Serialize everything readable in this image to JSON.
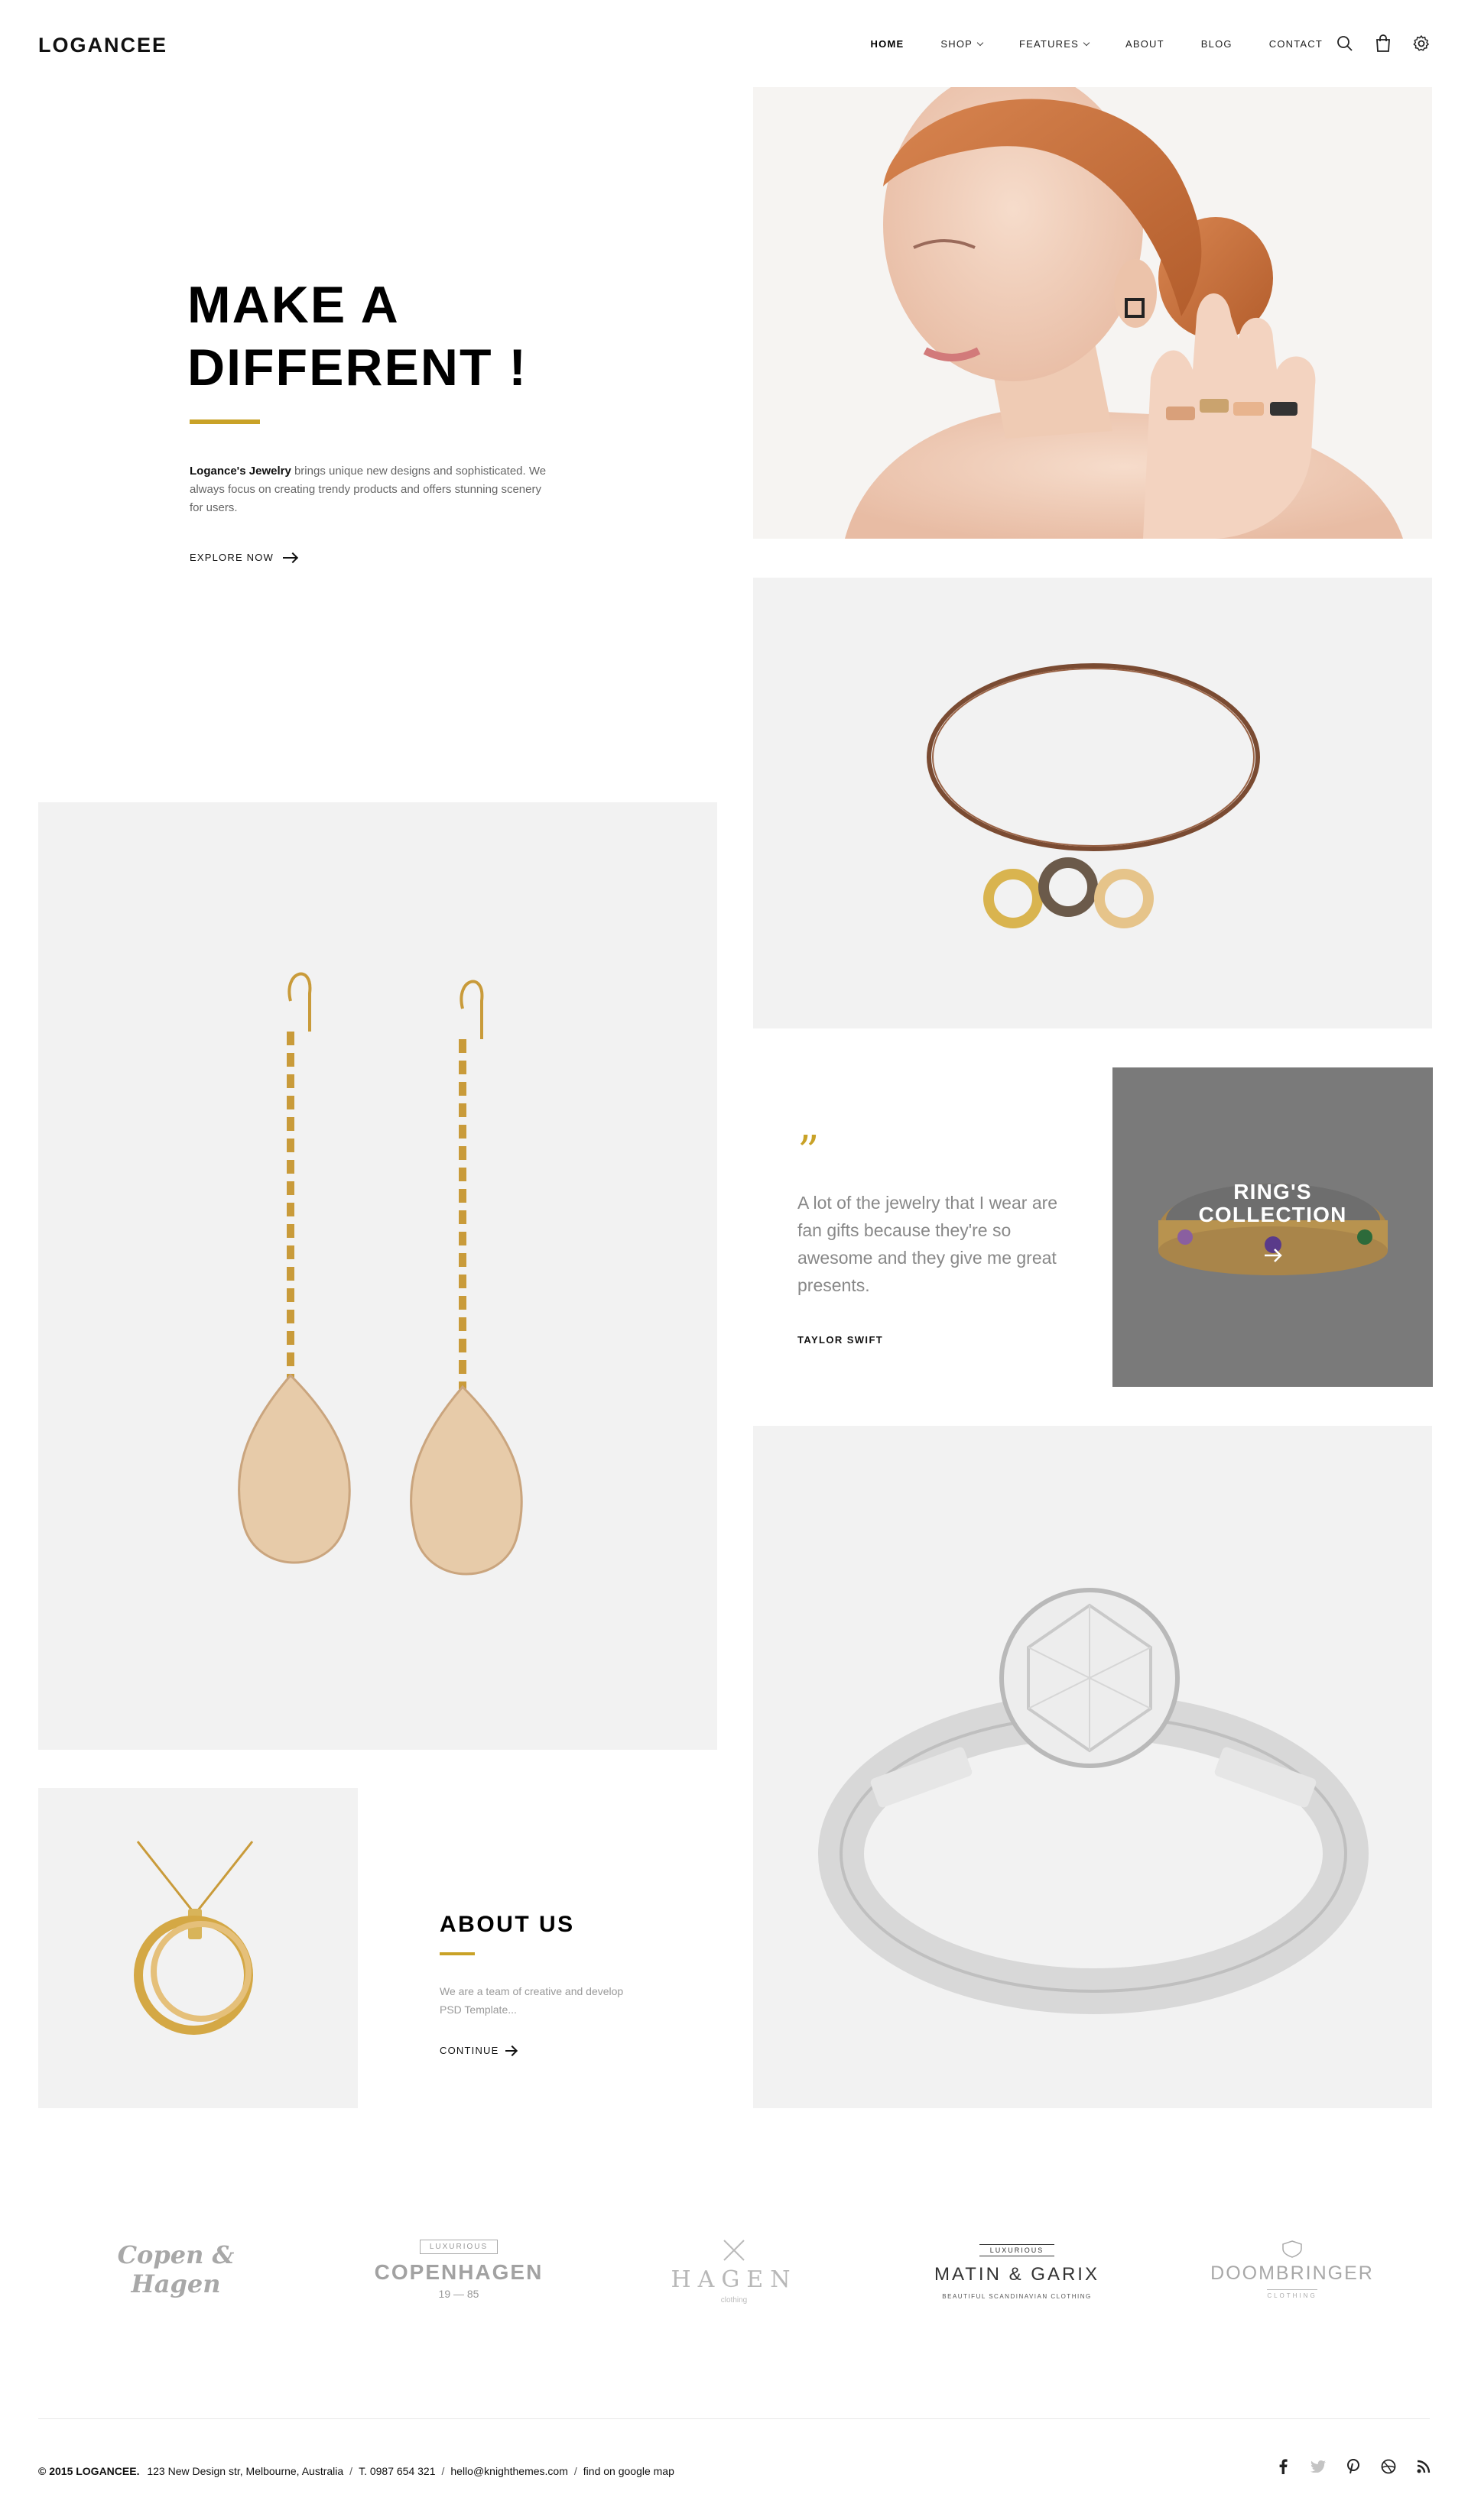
{
  "header": {
    "logo": "LOGANCEE",
    "nav": [
      {
        "label": "HOME",
        "active": true,
        "dropdown": false
      },
      {
        "label": "SHOP",
        "active": false,
        "dropdown": true
      },
      {
        "label": "FEATURES",
        "active": false,
        "dropdown": true
      },
      {
        "label": "ABOUT",
        "active": false,
        "dropdown": false
      },
      {
        "label": "BLOG",
        "active": false,
        "dropdown": false
      },
      {
        "label": "CONTACT",
        "active": false,
        "dropdown": false
      }
    ],
    "tools": [
      "search-icon",
      "shopping-bag-icon",
      "settings-gear-icon"
    ]
  },
  "hero": {
    "title": "MAKE A\nDIFFERENT !",
    "desc_bold": "Logance's Jewelry",
    "desc_rest": " brings unique new designs and sophisticated. We always focus on creating trendy products and offers stunning scenery for users.",
    "cta": "EXPLORE NOW"
  },
  "quote": {
    "mark": "”",
    "text": "A lot of the jewelry that I wear are fan gifts because they're so awesome and they give me great presents.",
    "author": "TAYLOR SWIFT"
  },
  "collection": {
    "title": "RING'S\nCOLLECTION"
  },
  "about": {
    "title": "ABOUT US",
    "desc": "We are a team of creative and develop PSD Template...",
    "cta": "CONTINUE"
  },
  "brands": {
    "b1": "Copen & Hagen",
    "b2_top": "LUXURIOUS",
    "b2_main": "COPENHAGEN",
    "b2_year_a": "19",
    "b2_year_b": "85",
    "b3_main": "HAGEN",
    "b3_sub": "clothing",
    "b4_top": "LUXURIOUS",
    "b4_main": "MATIN & GARIX",
    "b4_sub": "BEAUTIFUL SCANDINAVIAN CLOTHING",
    "b5_main": "DOOMBRINGER",
    "b5_sub": "CLOTHING"
  },
  "footer": {
    "copyright": "© 2015 LOGANCEE.",
    "address": "123 New Design str, Melbourne, Australia",
    "phone": "T. 0987 654 321",
    "email": "hello@knighthemes.com",
    "map": "find on google map",
    "socials": [
      "facebook-icon",
      "twitter-icon",
      "pinterest-icon",
      "dribbble-icon",
      "rss-icon"
    ]
  },
  "colors": {
    "accent": "#c9a227",
    "panel": "#f2f2f2",
    "collection_overlay": "#7a7a7a"
  }
}
